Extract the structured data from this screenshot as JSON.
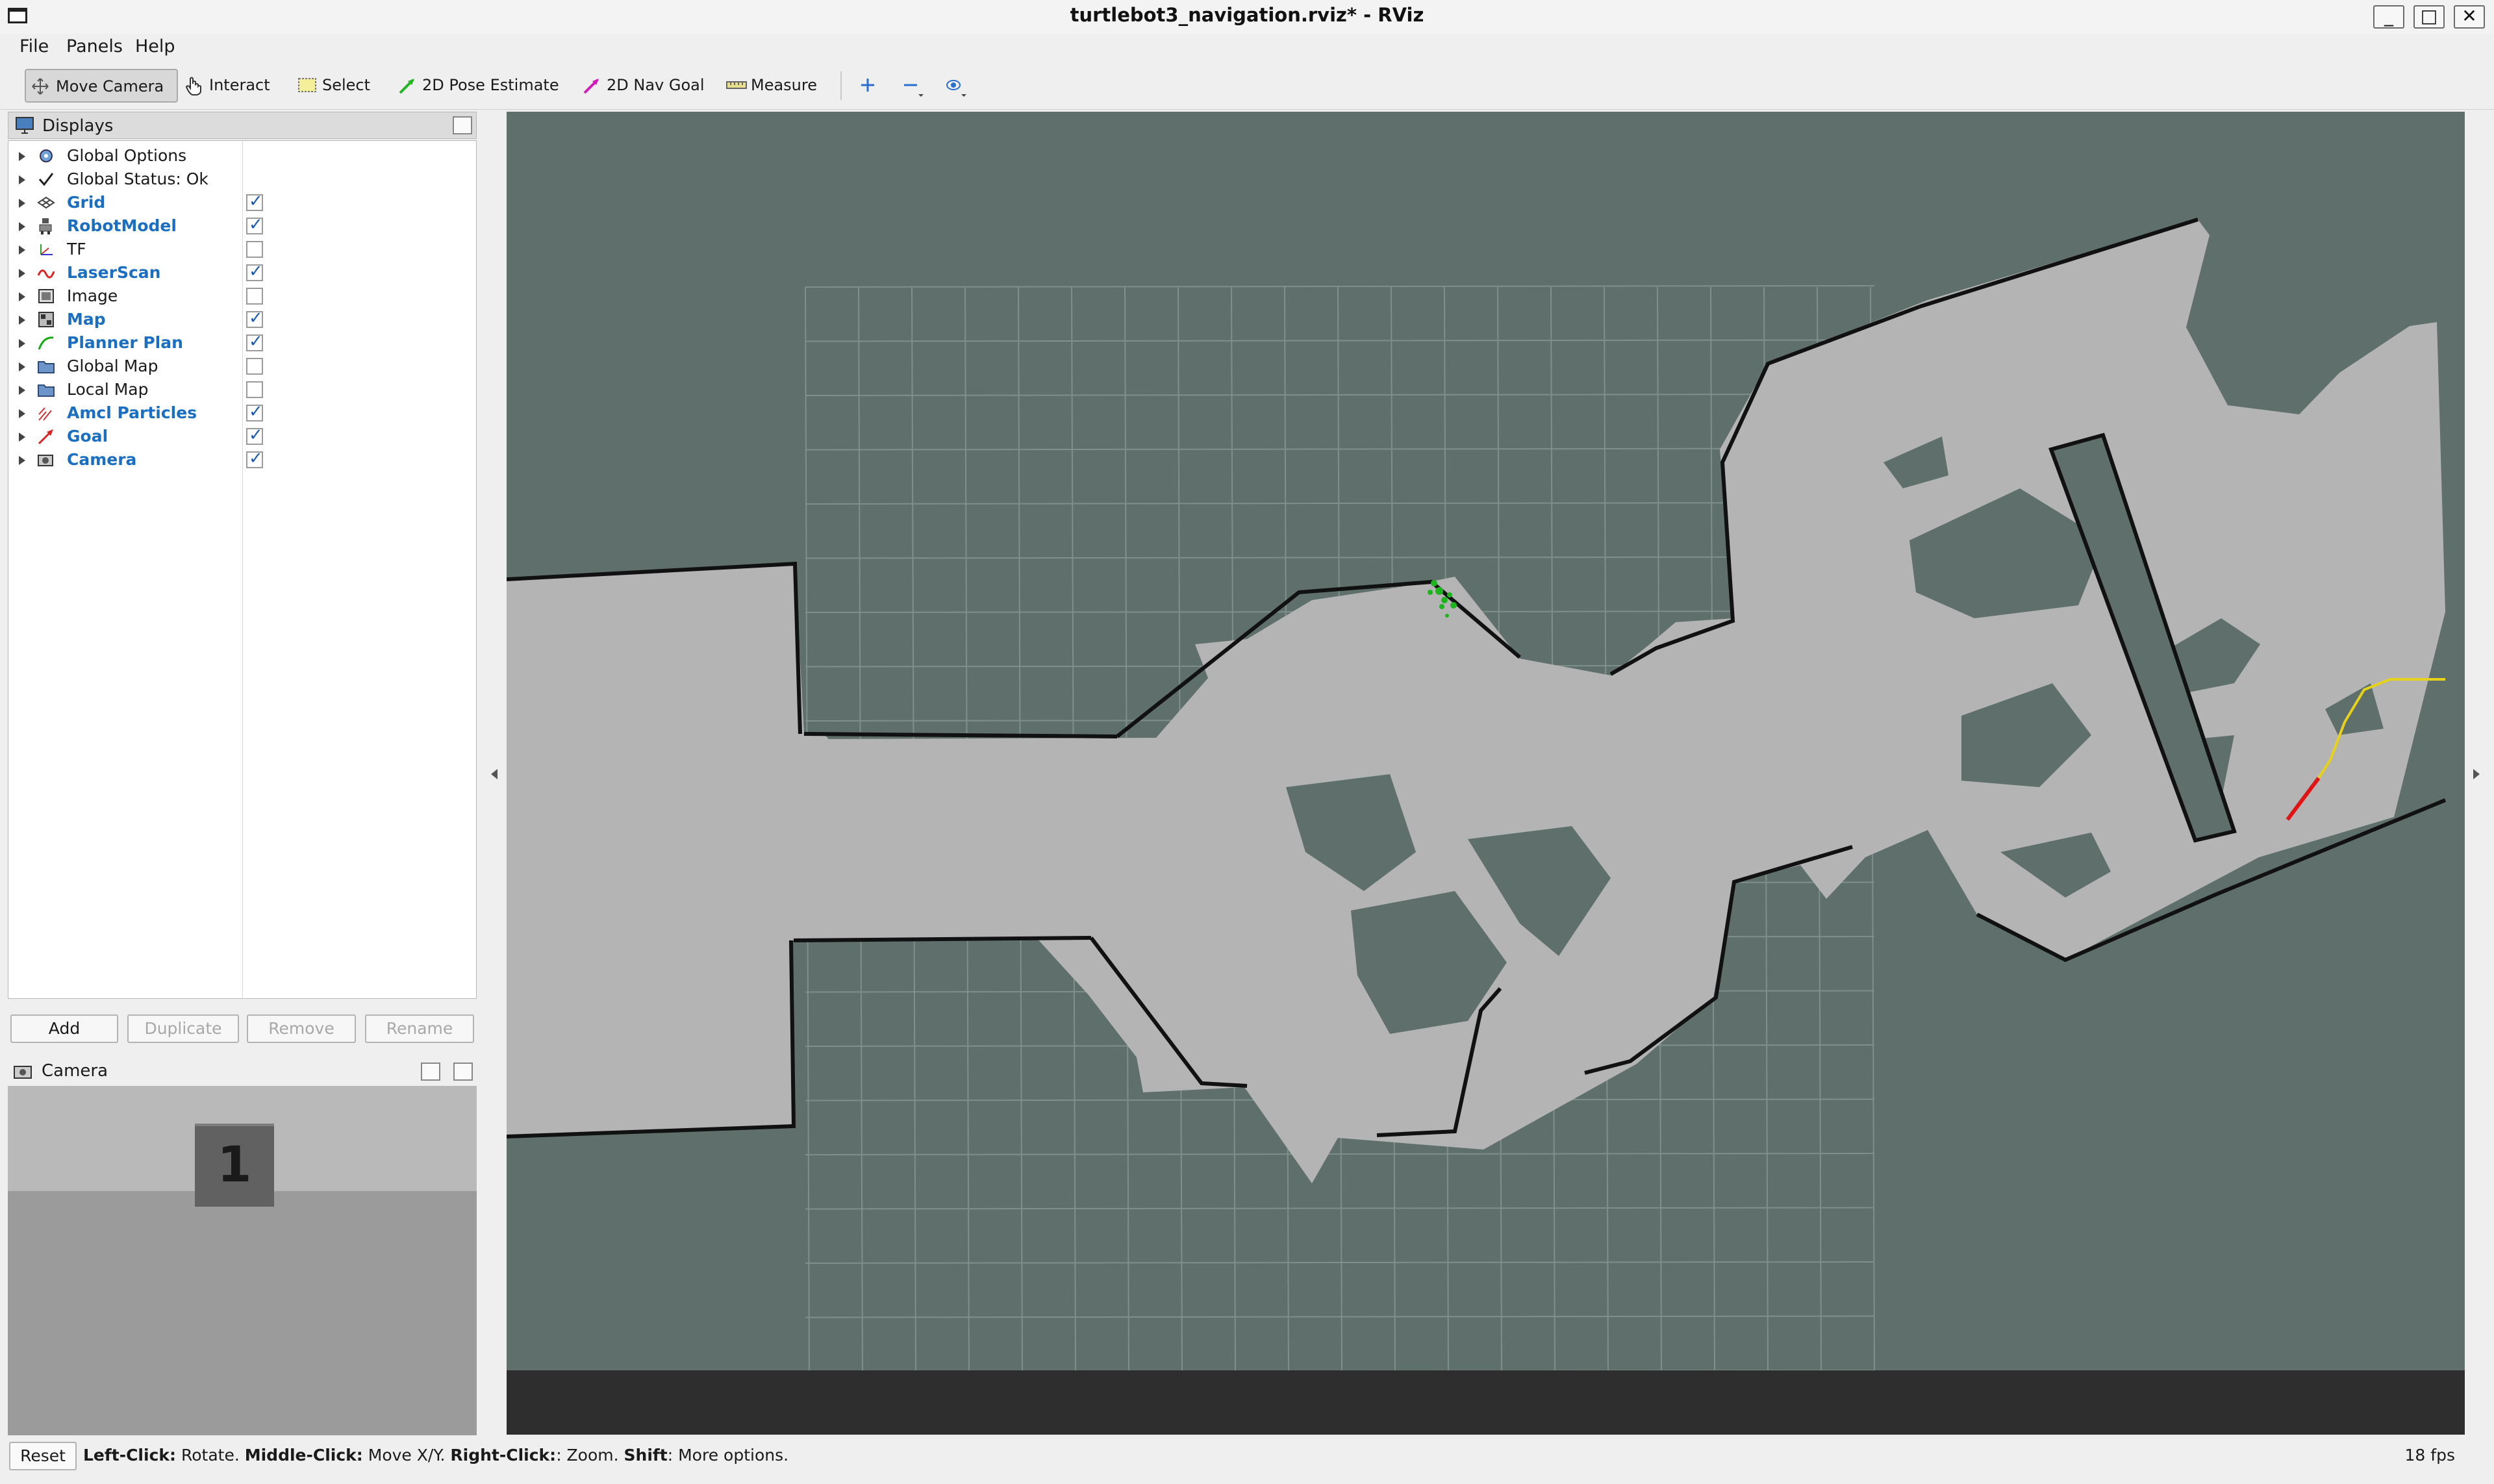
{
  "window": {
    "title": "turtlebot3_navigation.rviz* - RViz",
    "minimize_glyph": "_",
    "maximize_glyph": "□",
    "close_glyph": "✕"
  },
  "menu": [
    "File",
    "Panels",
    "Help"
  ],
  "toolbar": {
    "tools": [
      "Move Camera",
      "Interact",
      "Select",
      "2D Pose Estimate",
      "2D Nav Goal",
      "Measure"
    ],
    "active_tool": "Move Camera",
    "extra_icons": [
      "zoom-in-icon",
      "zoom-out-icon",
      "camera-view-icon"
    ]
  },
  "displays": {
    "title": "Displays",
    "items": [
      {
        "label": "Global Options",
        "icon": "gear-icon",
        "enabled": null
      },
      {
        "label": "Global Status: Ok",
        "icon": "checkmark-icon",
        "enabled": null
      },
      {
        "label": "Grid",
        "icon": "grid-icon",
        "enabled": true
      },
      {
        "label": "RobotModel",
        "icon": "robot-icon",
        "enabled": true
      },
      {
        "label": "TF",
        "icon": "tf-axes-icon",
        "enabled": false
      },
      {
        "label": "LaserScan",
        "icon": "laser-icon",
        "enabled": true
      },
      {
        "label": "Image",
        "icon": "image-icon",
        "enabled": false
      },
      {
        "label": "Map",
        "icon": "map-icon",
        "enabled": true
      },
      {
        "label": "Planner Plan",
        "icon": "path-icon",
        "enabled": true
      },
      {
        "label": "Global Map",
        "icon": "folder-icon",
        "enabled": false
      },
      {
        "label": "Local Map",
        "icon": "folder-icon",
        "enabled": false
      },
      {
        "label": "Amcl Particles",
        "icon": "pose-array-icon",
        "enabled": true
      },
      {
        "label": "Goal",
        "icon": "pose-icon",
        "enabled": true
      },
      {
        "label": "Camera",
        "icon": "camera-icon",
        "enabled": true
      }
    ],
    "buttons": [
      {
        "label": "Add",
        "enabled": true
      },
      {
        "label": "Duplicate",
        "enabled": false
      },
      {
        "label": "Remove",
        "enabled": false
      },
      {
        "label": "Rename",
        "enabled": false
      }
    ]
  },
  "camera_panel": {
    "title": "Camera",
    "marker_text": "1"
  },
  "status": {
    "reset_label": "Reset",
    "help": [
      {
        "text": "Left-Click:",
        "bold": true
      },
      {
        "text": " Rotate. ",
        "bold": false
      },
      {
        "text": "Middle-Click:",
        "bold": true
      },
      {
        "text": " Move X/Y. ",
        "bold": false
      },
      {
        "text": "Right-Click:",
        "bold": true
      },
      {
        "text": ": Zoom. ",
        "bold": false
      },
      {
        "text": "Shift",
        "bold": true
      },
      {
        "text": ": More options.",
        "bold": false
      }
    ],
    "fps": "18 fps"
  },
  "colors": {
    "background_3d": "#5f706c",
    "map_free": "#b4b4b4",
    "map_wall": "#111111",
    "grid": "#7f8f8b",
    "particles": "#1db51d",
    "plan": "#e6d21a",
    "goal": "#e01414",
    "link_blue": "#1b6fc2"
  }
}
